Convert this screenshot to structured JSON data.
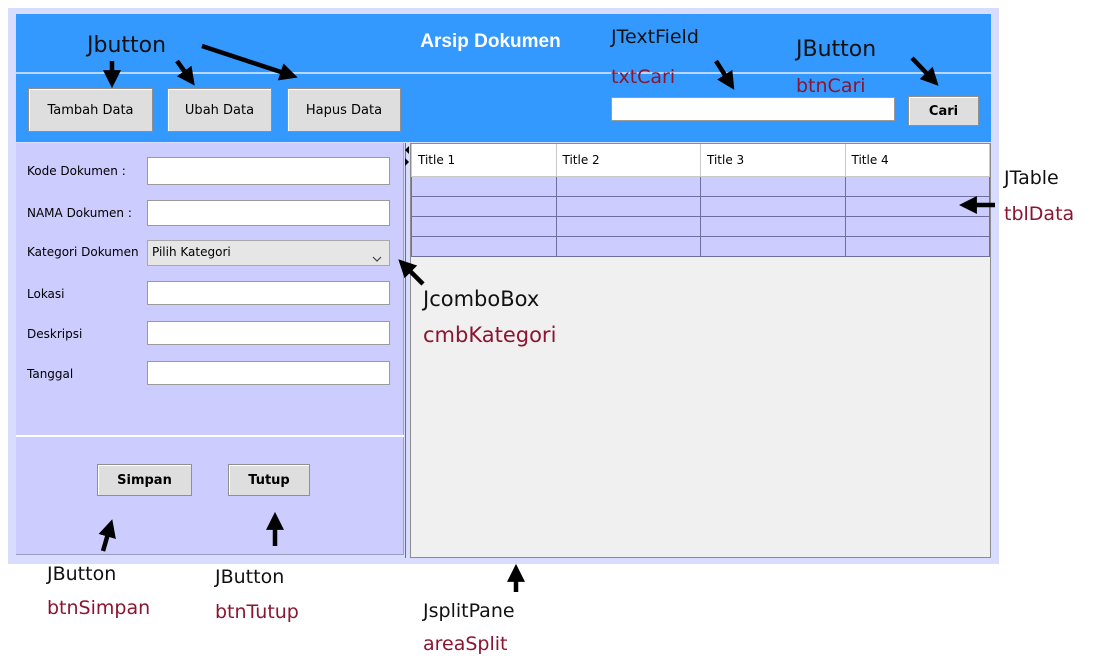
{
  "window": {
    "title": "Arsip Dokumen"
  },
  "toolbar": {
    "buttons": [
      "Tambah Data",
      "Ubah Data",
      "Hapus Data"
    ],
    "search_value": "",
    "search_button": "Cari"
  },
  "form": {
    "fields": [
      {
        "label": "Kode Dokumen :",
        "value": ""
      },
      {
        "label": "NAMA Dokumen :",
        "value": ""
      },
      {
        "label": "Kategori Dokumen",
        "value": "Pilih Kategori"
      },
      {
        "label": "Lokasi",
        "value": ""
      },
      {
        "label": "Deskripsi",
        "value": ""
      },
      {
        "label": "Tanggal",
        "value": ""
      }
    ],
    "save_button": "Simpan",
    "close_button": "Tutup"
  },
  "table": {
    "columns": [
      "Title 1",
      "Title 2",
      "Title 3",
      "Title 4"
    ],
    "rows": [
      [
        "",
        "",
        "",
        ""
      ],
      [
        "",
        "",
        "",
        ""
      ],
      [
        "",
        "",
        "",
        ""
      ],
      [
        "",
        "",
        "",
        ""
      ]
    ]
  },
  "annotations": {
    "jbutton_top": "Jbutton",
    "jtextfield": "JTextField",
    "txtcari": "txtCari",
    "jbutton_cari": "JButton",
    "btncari": "btnCari",
    "jtable": "JTable",
    "tbldata": "tblData",
    "jcombobox": "JcomboBox",
    "cmbkategori": "cmbKategori",
    "jbutton_simpan": "JButton",
    "btnsimpan": "btnSimpan",
    "jbutton_tutup": "JButton",
    "btntutup": "btnTutup",
    "jsplitpane": "JsplitPane",
    "areasplit": "areaSplit"
  },
  "icons": {
    "combo_arrow": "chevron-down-icon",
    "annotation_arrows": "arrow-icon"
  }
}
